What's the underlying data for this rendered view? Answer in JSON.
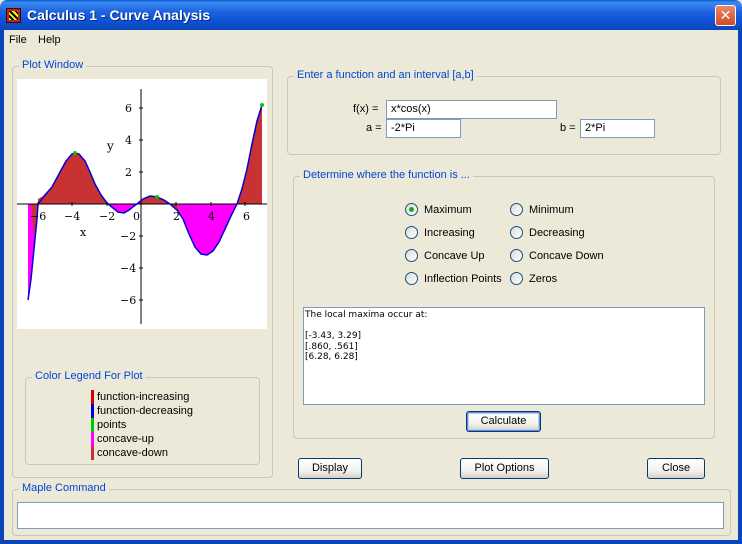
{
  "window": {
    "title": "Calculus 1 - Curve Analysis",
    "close_glyph": "✕"
  },
  "menu": {
    "items": [
      "File",
      "Help"
    ]
  },
  "plot_window": {
    "title": "Plot Window",
    "x_label": "x",
    "y_label": "y",
    "x_ticks": [
      "−6",
      "−4",
      "−2",
      "0",
      "2",
      "4",
      "6"
    ],
    "y_ticks": [
      "6",
      "4",
      "2",
      "−2",
      "−4",
      "−6"
    ]
  },
  "legend": {
    "title": "Color Legend For Plot",
    "items": [
      {
        "label": "function-increasing",
        "color": "#d40000"
      },
      {
        "label": "function-decreasing",
        "color": "#0000d4"
      },
      {
        "label": "points",
        "color": "#00c800"
      },
      {
        "label": "concave-up",
        "color": "#ff00ff"
      },
      {
        "label": "concave-down",
        "color": "#c83232"
      }
    ]
  },
  "input_panel": {
    "title": "Enter a function and an interval [a,b]",
    "fx_label": "f(x) =",
    "fx_value": "x*cos(x)",
    "a_label": "a =",
    "a_value": "-2*Pi",
    "b_label": "b =",
    "b_value": "2*Pi"
  },
  "determine_panel": {
    "title": "Determine where the function is ...",
    "options": [
      {
        "label": "Maximum",
        "checked": true
      },
      {
        "label": "Minimum",
        "checked": false
      },
      {
        "label": "Increasing",
        "checked": false
      },
      {
        "label": "Decreasing",
        "checked": false
      },
      {
        "label": "Concave Up",
        "checked": false
      },
      {
        "label": "Concave Down",
        "checked": false
      },
      {
        "label": "Inflection Points",
        "checked": false
      },
      {
        "label": "Zeros",
        "checked": false
      }
    ],
    "output_lines": [
      "The local maxima occur at:",
      "",
      "[-3.43, 3.29]",
      "[.860, .561]",
      "[6.28, 6.28]"
    ],
    "calculate_label": "Calculate"
  },
  "buttons": {
    "display": "Display",
    "plot_options": "Plot Options",
    "close": "Close"
  },
  "maple": {
    "title": "Maple Command",
    "value": ""
  },
  "colors": {
    "accent": "#0046d5",
    "title_bar": "#0b46b8"
  }
}
